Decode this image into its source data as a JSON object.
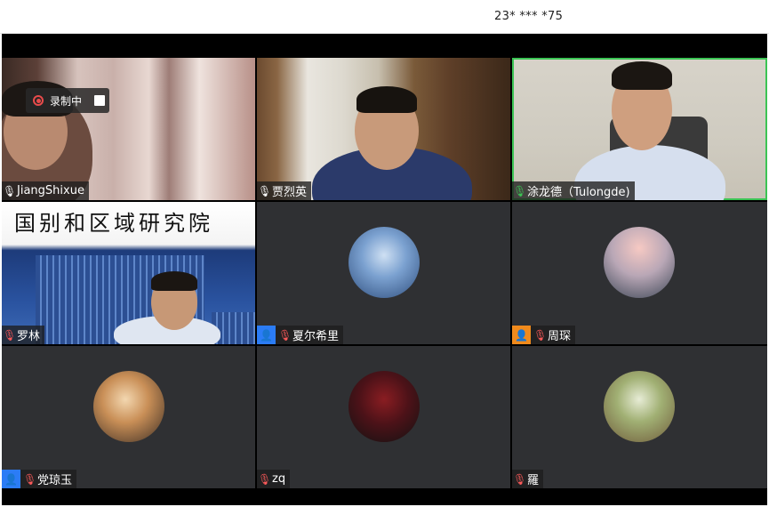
{
  "titlebar": {
    "meeting_id": "23* *** *75"
  },
  "recording": {
    "label": "录制中"
  },
  "participants": [
    {
      "name": "JiangShixue",
      "mic": "on-white",
      "video": true
    },
    {
      "name": "贾烈英",
      "mic": "on-white",
      "video": true
    },
    {
      "name": "涂龙德（Tulongde)",
      "mic": "speaking",
      "video": true,
      "active_speaker": true
    },
    {
      "name": "罗林",
      "mic": "muted",
      "video": true,
      "background_text": "国别和区域研究院"
    },
    {
      "name": "夏尔希里",
      "mic": "muted",
      "video": false,
      "badge": "user-icon"
    },
    {
      "name": "周琛",
      "mic": "muted",
      "video": false,
      "badge": "user-icon-orange"
    },
    {
      "name": "党琼玉",
      "mic": "muted",
      "video": false,
      "badge": "user-icon"
    },
    {
      "name": "zq",
      "mic": "muted",
      "video": false
    },
    {
      "name": "羅",
      "mic": "muted",
      "video": false
    }
  ],
  "colors": {
    "active_border": "#3bc454",
    "badge_blue": "#2b7cf6",
    "badge_orange": "#f08a1c",
    "muted_red": "#ff5a5a"
  }
}
